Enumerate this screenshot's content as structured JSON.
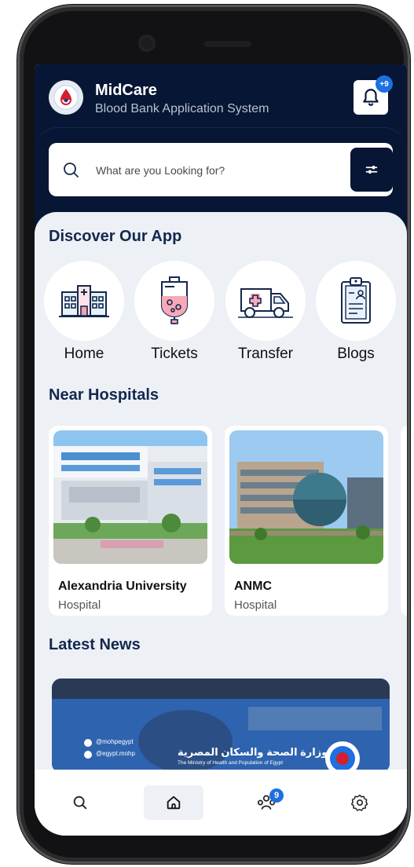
{
  "app": {
    "title": "MidCare",
    "subtitle": "Blood Bank Application System",
    "notification_count": "+9"
  },
  "search": {
    "placeholder": "What are you Looking for?"
  },
  "sections": {
    "discover": "Discover Our App",
    "hospitals": "Near Hospitals",
    "news": "Latest News"
  },
  "categories": [
    {
      "label": "Home",
      "icon": "hospital-building-icon"
    },
    {
      "label": "Tickets",
      "icon": "blood-bag-icon"
    },
    {
      "label": "Transfer",
      "icon": "ambulance-icon"
    },
    {
      "label": "Blogs",
      "icon": "clipboard-icon"
    }
  ],
  "hospitals": [
    {
      "name": "Alexandria University",
      "type": "Hospital"
    },
    {
      "name": "ANMC",
      "type": "Hospital"
    }
  ],
  "news": {
    "arabic_title": "وزارة الصحة والسكان المصرية",
    "english_title": "The Ministry of Health and Population of Egypt",
    "handle_twitter": "@mohpegypt",
    "handle_facebook": "@egypt.mohp"
  },
  "navbar": {
    "items": [
      "search-icon",
      "home-icon",
      "users-icon",
      "settings-icon"
    ],
    "users_badge": "9",
    "active": "home-icon"
  },
  "colors": {
    "primary_dark": "#071634",
    "accent_blue": "#1e6fe0",
    "background": "#edf0f5",
    "blood_red": "#d3202e"
  }
}
